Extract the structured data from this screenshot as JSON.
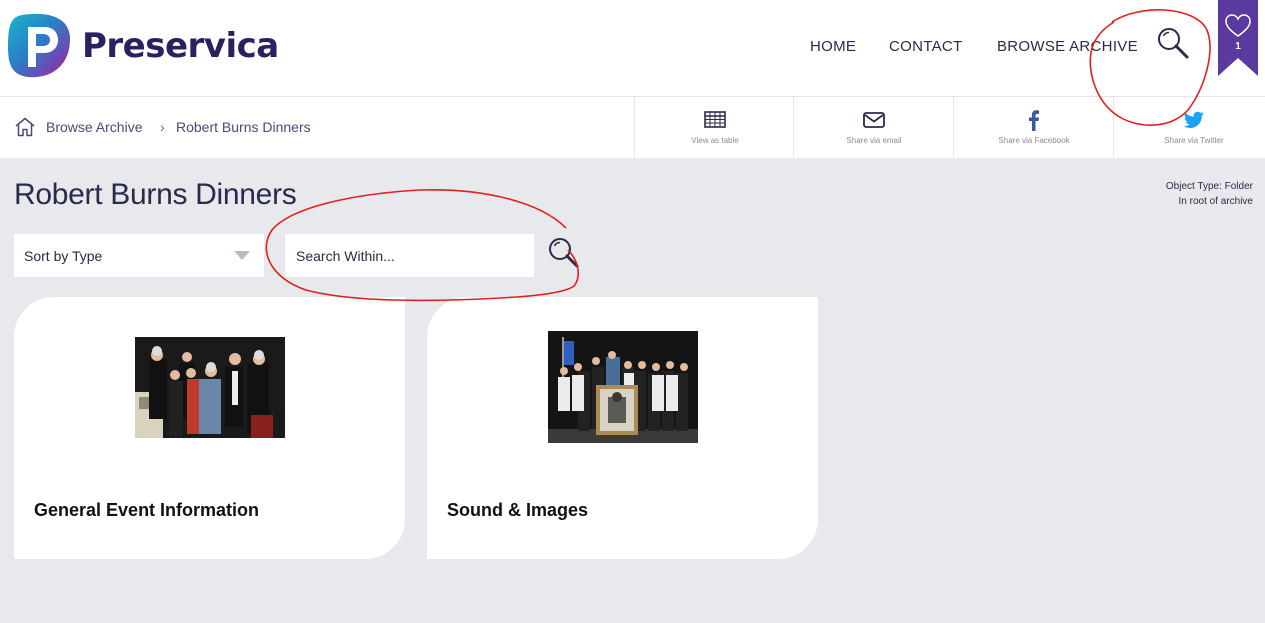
{
  "header": {
    "brand": "Preservica",
    "nav": {
      "home": "HOME",
      "contact": "CONTACT",
      "browse": "BROWSE ARCHIVE"
    },
    "search_icon": "search-icon",
    "bookmark_count": "1",
    "accent_color": "#5b3aa0"
  },
  "breadcrumb": {
    "items": [
      "Browse Archive",
      "Robert Burns Dinners"
    ],
    "separator": "›"
  },
  "share": [
    {
      "label": "View as table",
      "icon": "table-icon"
    },
    {
      "label": "Share via email",
      "icon": "email-icon"
    },
    {
      "label": "Share via Facebook",
      "icon": "facebook-icon"
    },
    {
      "label": "Share via Twitter",
      "icon": "twitter-icon"
    }
  ],
  "page": {
    "title": "Robert Burns Dinners",
    "object_type": "Object Type: Folder",
    "location": "In root of archive"
  },
  "controls": {
    "sort_value": "Sort by Type",
    "search_placeholder": "Search Within..."
  },
  "cards": [
    {
      "title": "General Event Information"
    },
    {
      "title": "Sound & Images"
    }
  ],
  "annotation_color": "#e02020"
}
